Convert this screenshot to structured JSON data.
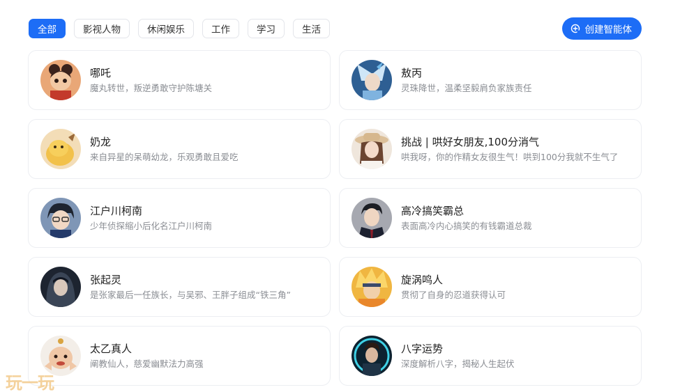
{
  "tabs": [
    {
      "label": "全部",
      "active": true
    },
    {
      "label": "影视人物",
      "active": false
    },
    {
      "label": "休闲娱乐",
      "active": false
    },
    {
      "label": "工作",
      "active": false
    },
    {
      "label": "学习",
      "active": false
    },
    {
      "label": "生活",
      "active": false
    }
  ],
  "create_button": {
    "label": "创建智能体",
    "icon": "plus-circle-icon"
  },
  "cards": [
    {
      "name": "哪吒",
      "desc": "魔丸转世，叛逆勇敢守护陈塘关"
    },
    {
      "name": "敖丙",
      "desc": "灵珠降世，温柔坚毅肩负家族责任"
    },
    {
      "name": "奶龙",
      "desc": "来自异星的呆萌幼龙，乐观勇敢且爱吃"
    },
    {
      "name": "挑战 | 哄好女朋友,100分消气",
      "desc": "哄我呀，你的作精女友很生气！哄到100分我就不生气了"
    },
    {
      "name": "江户川柯南",
      "desc": "少年侦探缩小后化名江户川柯南"
    },
    {
      "name": "高冷搞笑霸总",
      "desc": "表面高冷内心搞笑的有钱霸道总裁"
    },
    {
      "name": "张起灵",
      "desc": "是张家最后一任族长，与吴邪、王胖子组成“铁三角”"
    },
    {
      "name": "旋涡鸣人",
      "desc": "贯彻了自身的忍道获得认可"
    },
    {
      "name": "太乙真人",
      "desc": "阐教仙人，慈爱幽默法力高强"
    },
    {
      "name": "八字运势",
      "desc": "深度解析八字，揭秘人生起伏"
    }
  ],
  "watermark": "玩一玩",
  "colors": {
    "accent": "#1d6df6",
    "border": "#eceef2",
    "desc": "#8a8d93"
  }
}
